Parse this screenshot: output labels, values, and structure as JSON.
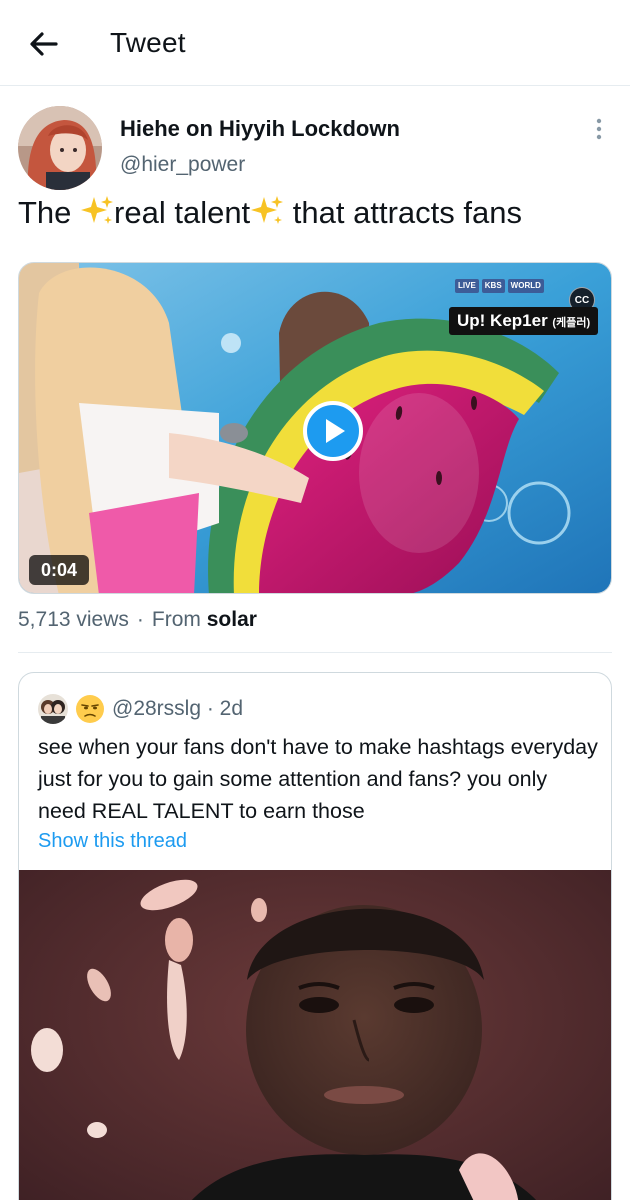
{
  "header": {
    "title": "Tweet",
    "back_icon": "arrow-left-icon"
  },
  "tweet": {
    "display_name": "Hiehe on Hiyyih Lockdown",
    "handle": "@hier_power",
    "text_parts": [
      "The ",
      "real talent",
      " that attracts fans"
    ],
    "sparkle_icon": "sparkles-emoji",
    "more_icon": "vertical-ellipsis-icon",
    "media": {
      "duration": "0:04",
      "play_icon": "play-icon",
      "cc_label": "CC",
      "broadcast_labels": [
        "LIVE",
        "KBS",
        "WORLD"
      ],
      "caption_main": "Up! Kep1er",
      "caption_sub": "(케플러)"
    },
    "views": "5,713 views",
    "separator": "·",
    "from_label": "From",
    "source": "solar"
  },
  "quote": {
    "handle": "@28rsslg",
    "time": "· 2d",
    "emoji": "unamused-face-emoji",
    "text": "see when your fans don't have to make hashtags everyday just for you to gain some attention and fans? you only need REAL TALENT to earn those",
    "show_thread": "Show this thread"
  },
  "colors": {
    "accent": "#1d9bf0",
    "secondary_text": "#536471",
    "border": "#cfd9de"
  }
}
